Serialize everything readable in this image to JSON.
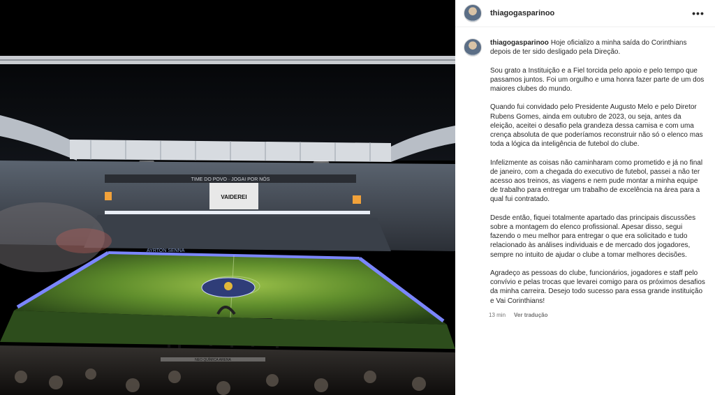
{
  "post": {
    "username": "thiagogasparinoo",
    "caption": {
      "paragraphs": [
        "Hoje oficializo a minha saída do Corinthians depois de ter sido desligado pela Direção.",
        "Sou grato a Instituição e a Fiel torcida pelo apoio e pelo tempo que passamos juntos. Foi um orgulho e uma honra fazer parte de um dos maiores clubes do mundo.",
        "Quando fui convidado pelo Presidente Augusto Melo e pelo Diretor Rubens Gomes, ainda em outubro de 2023, ou seja, antes da eleição, aceitei o desafio pela grandeza dessa camisa e com uma crença absoluta de que poderíamos reconstruir não só o elenco mas toda a lógica da inteligência de futebol do clube.",
        "Infelizmente as coisas não caminharam como prometido e já no final de janeiro, com a chegada do executivo de futebol, passei a não ter acesso aos treinos, as viagens e nem pude montar a minha equipe de trabalho para entregar um trabalho de excelência na área para a qual fui contratado.",
        "Desde então, fiquei totalmente apartado das principais discussões sobre a montagem do elenco profissional. Apesar disso, segui fazendo o meu melhor para entregar o que era solicitado e tudo relacionado às análises individuais e de mercado dos jogadores, sempre no intuito de ajudar o clube a tomar melhores decisões.",
        "Agradeço as pessoas do clube, funcionários, jogadores e staff pelo convívio e pelas trocas que levarei comigo para os próximos desafios da minha carreira. Desejo todo sucesso para essa grande instituição e Vai Corinthians!"
      ]
    },
    "time_ago": "13 min",
    "translate_label": "Ver tradução",
    "more_icon": "•••"
  },
  "image": {
    "banner_text": "TIME DO POVO · JOGAI POR NÓS",
    "flag_text": "VAIDEREI",
    "ribbon_text": "NEO QUÍMICA ARENA",
    "sideline_text": "AYRTON SENNA"
  },
  "colors": {
    "username": "#262626",
    "meta": "#737373",
    "led": "#6f7cff"
  }
}
